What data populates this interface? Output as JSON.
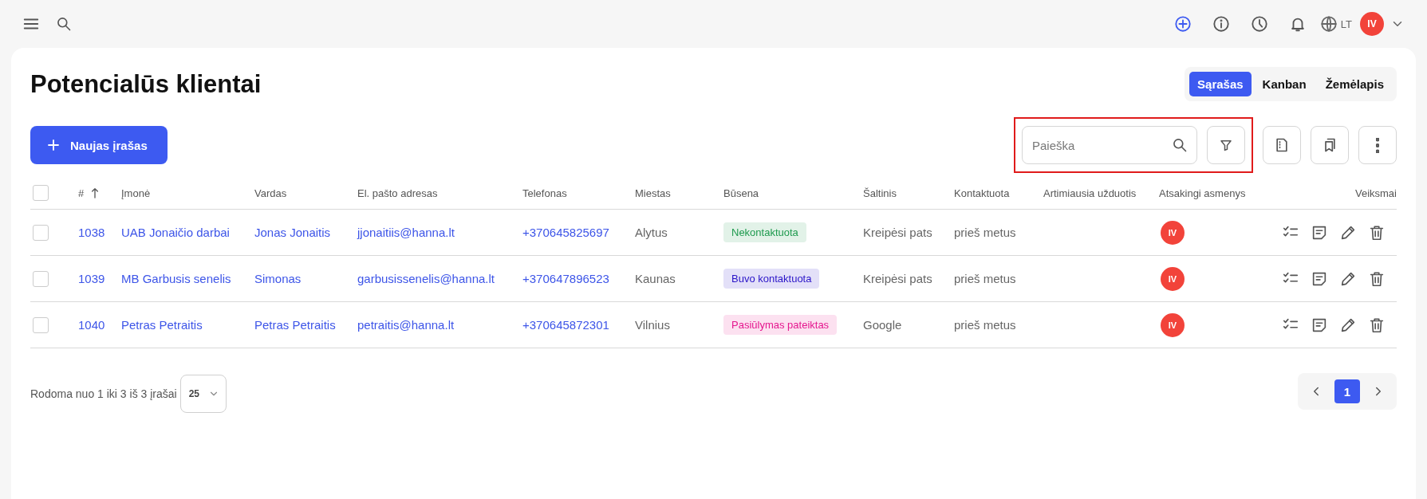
{
  "topbar": {
    "language": "LT",
    "user_initials": "IV"
  },
  "page": {
    "title": "Potencialūs klientai",
    "views": [
      {
        "label": "Sąrašas",
        "selected": true
      },
      {
        "label": "Kanban",
        "selected": false
      },
      {
        "label": "Žemėlapis",
        "selected": false
      }
    ]
  },
  "toolbar": {
    "new_button": "Naujas įrašas",
    "search": {
      "placeholder": "Paieška"
    },
    "highlighted": true
  },
  "table": {
    "select_all_checked": false,
    "columns": [
      "#",
      "Įmonė",
      "Vardas",
      "El. pašto adresas",
      "Telefonas",
      "Miestas",
      "Būsena",
      "Šaltinis",
      "Kontaktuota",
      "Artimiausia užduotis",
      "Atsakingi asmenys",
      "Veiksmai"
    ],
    "rows": [
      {
        "checked": false,
        "id": "1038",
        "company": "UAB Jonaičio darbai",
        "name": "Jonas Jonaitis",
        "email": "jjonaitiis@hanna.lt",
        "phone": "+370645825697",
        "city": "Alytus",
        "status": {
          "label": "Nekontaktuota",
          "color": "#1e9a4e"
        },
        "source": "Kreipėsi pats",
        "contacted": "prieš metus",
        "assignee": "IV"
      },
      {
        "checked": false,
        "id": "1039",
        "company": "MB Garbusis senelis",
        "name": "Simonas",
        "email": "garbusissenelis@hanna.lt",
        "phone": "+370647896523",
        "city": "Kaunas",
        "status": {
          "label": "Buvo kontaktuota",
          "color": "#2a14c8"
        },
        "source": "Kreipėsi pats",
        "contacted": "prieš metus",
        "assignee": "IV"
      },
      {
        "checked": false,
        "id": "1040",
        "company": "Petras Petraitis",
        "name": "Petras Petraitis",
        "email": "petraitis@hanna.lt",
        "phone": "+370645872301",
        "city": "Vilnius",
        "status": {
          "label": "Pasiūlymas pateiktas",
          "color": "#e5178f"
        },
        "source": "Google",
        "contacted": "prieš metus",
        "assignee": "IV"
      }
    ]
  },
  "footer": {
    "summary": "Rodoma nuo 1 iki 3 iš 3 įrašai",
    "per_page": "25",
    "pages": [
      {
        "label": "1",
        "selected": true
      }
    ]
  }
}
